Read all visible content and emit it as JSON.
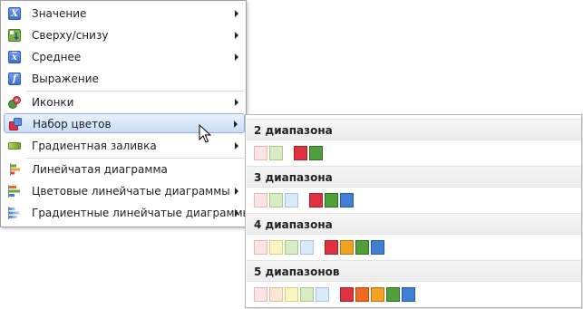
{
  "menu": {
    "items": [
      {
        "label": "Значение",
        "icon": "x-value-icon",
        "submenu": true
      },
      {
        "label": "Сверху/снизу",
        "icon": "top-bottom-icon",
        "submenu": true
      },
      {
        "label": "Среднее",
        "icon": "x-average-icon",
        "submenu": true
      },
      {
        "label": "Выражение",
        "icon": "function-icon",
        "submenu": false
      },
      {
        "label": "Иконки",
        "icon": "icon-set-icon",
        "submenu": true
      },
      {
        "label": "Набор цветов",
        "icon": "color-scale-icon",
        "submenu": true,
        "highlighted": true
      },
      {
        "label": "Градиентная заливка",
        "icon": "gradient-fill-icon",
        "submenu": true
      },
      {
        "label": "Линейчатая диаграмма",
        "icon": "data-bar-icon",
        "submenu": false
      },
      {
        "label": "Цветовые линейчатые диаграммы",
        "icon": "color-data-bars-icon",
        "submenu": true
      },
      {
        "label": "Градиентные линейчатые диаграммы",
        "icon": "gradient-data-bars-icon",
        "submenu": true
      }
    ]
  },
  "submenu": {
    "sections": [
      {
        "title": "2 диапазона",
        "light": [
          {
            "fill": "#fde3e3",
            "border": "#e7b6b6"
          },
          {
            "fill": "#d7ecc2",
            "border": "#a6c986"
          }
        ],
        "dark": [
          {
            "fill": "#e0313f",
            "border": "#a3222c"
          },
          {
            "fill": "#4f9f3a",
            "border": "#336b25"
          }
        ]
      },
      {
        "title": "3 диапазона",
        "light": [
          {
            "fill": "#fde3e3",
            "border": "#e7b6b6"
          },
          {
            "fill": "#d7ecc2",
            "border": "#a6c986"
          },
          {
            "fill": "#d9ebfa",
            "border": "#a4c4e3"
          }
        ],
        "dark": [
          {
            "fill": "#e0313f",
            "border": "#a3222c"
          },
          {
            "fill": "#4f9f3a",
            "border": "#336b25"
          },
          {
            "fill": "#3f7fd5",
            "border": "#2a5a9e"
          }
        ]
      },
      {
        "title": "4 диапазона",
        "light": [
          {
            "fill": "#fde3e3",
            "border": "#e7b6b6"
          },
          {
            "fill": "#fdf5bf",
            "border": "#ddd083"
          },
          {
            "fill": "#d7ecc2",
            "border": "#a6c986"
          },
          {
            "fill": "#d9ebfa",
            "border": "#a4c4e3"
          }
        ],
        "dark": [
          {
            "fill": "#e0313f",
            "border": "#a3222c"
          },
          {
            "fill": "#f2a21c",
            "border": "#b47510"
          },
          {
            "fill": "#4f9f3a",
            "border": "#336b25"
          },
          {
            "fill": "#3f7fd5",
            "border": "#2a5a9e"
          }
        ]
      },
      {
        "title": "5 диапазонов",
        "light": [
          {
            "fill": "#fde3e3",
            "border": "#e7b6b6"
          },
          {
            "fill": "#fde5d3",
            "border": "#e5bd9d"
          },
          {
            "fill": "#fdf5bf",
            "border": "#ddd083"
          },
          {
            "fill": "#d7ecc2",
            "border": "#a6c986"
          },
          {
            "fill": "#d9ebfa",
            "border": "#a4c4e3"
          }
        ],
        "dark": [
          {
            "fill": "#e0313f",
            "border": "#a3222c"
          },
          {
            "fill": "#ef6a1d",
            "border": "#b14a10"
          },
          {
            "fill": "#f2a21c",
            "border": "#b47510"
          },
          {
            "fill": "#4f9f3a",
            "border": "#336b25"
          },
          {
            "fill": "#3f7fd5",
            "border": "#2a5a9e"
          }
        ]
      }
    ]
  }
}
